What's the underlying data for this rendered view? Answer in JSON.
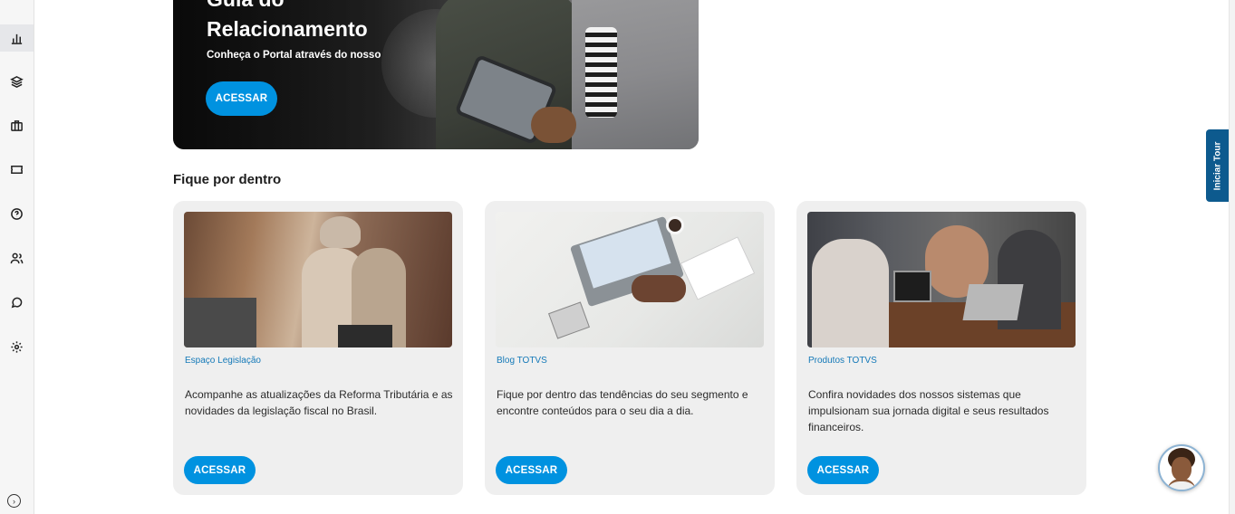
{
  "sidebar": {
    "items": [
      {
        "icon": "bar-chart-icon"
      },
      {
        "icon": "layers-icon"
      },
      {
        "icon": "briefcase-icon"
      },
      {
        "icon": "ticket-icon"
      },
      {
        "icon": "help-circle-icon"
      },
      {
        "icon": "users-icon"
      },
      {
        "icon": "chat-icon"
      },
      {
        "icon": "settings-icon"
      }
    ],
    "expand_icon": "chevron-right-circle-icon"
  },
  "hero": {
    "title_line1": "Guia do",
    "title_line2": "Relacionamento",
    "subtitle": "Conheça o Portal através do nosso",
    "button_label": "ACESSAR"
  },
  "section": {
    "title": "Fique por dentro"
  },
  "cards": [
    {
      "category": "Espaço Legislação",
      "description": "Acompanhe as atualizações da Reforma Tributária e as novidades da legislação fiscal no Brasil.",
      "button_label": "ACESSAR"
    },
    {
      "category": "Blog TOTVS",
      "description": "Fique por dentro das tendências do seu segmento e encontre conteúdos para o seu dia a dia.",
      "button_label": "ACESSAR"
    },
    {
      "category": "Produtos TOTVS",
      "description": "Confira novidades dos nossos sistemas que impulsionam sua jornada digital e seus resultados financeiros.",
      "button_label": "ACESSAR"
    }
  ],
  "tour": {
    "label": "Iniciar Tour"
  },
  "colors": {
    "accent": "#0092e0",
    "link": "#1479b8",
    "tour_bg": "#0d5a8e",
    "card_bg": "#efefef"
  }
}
